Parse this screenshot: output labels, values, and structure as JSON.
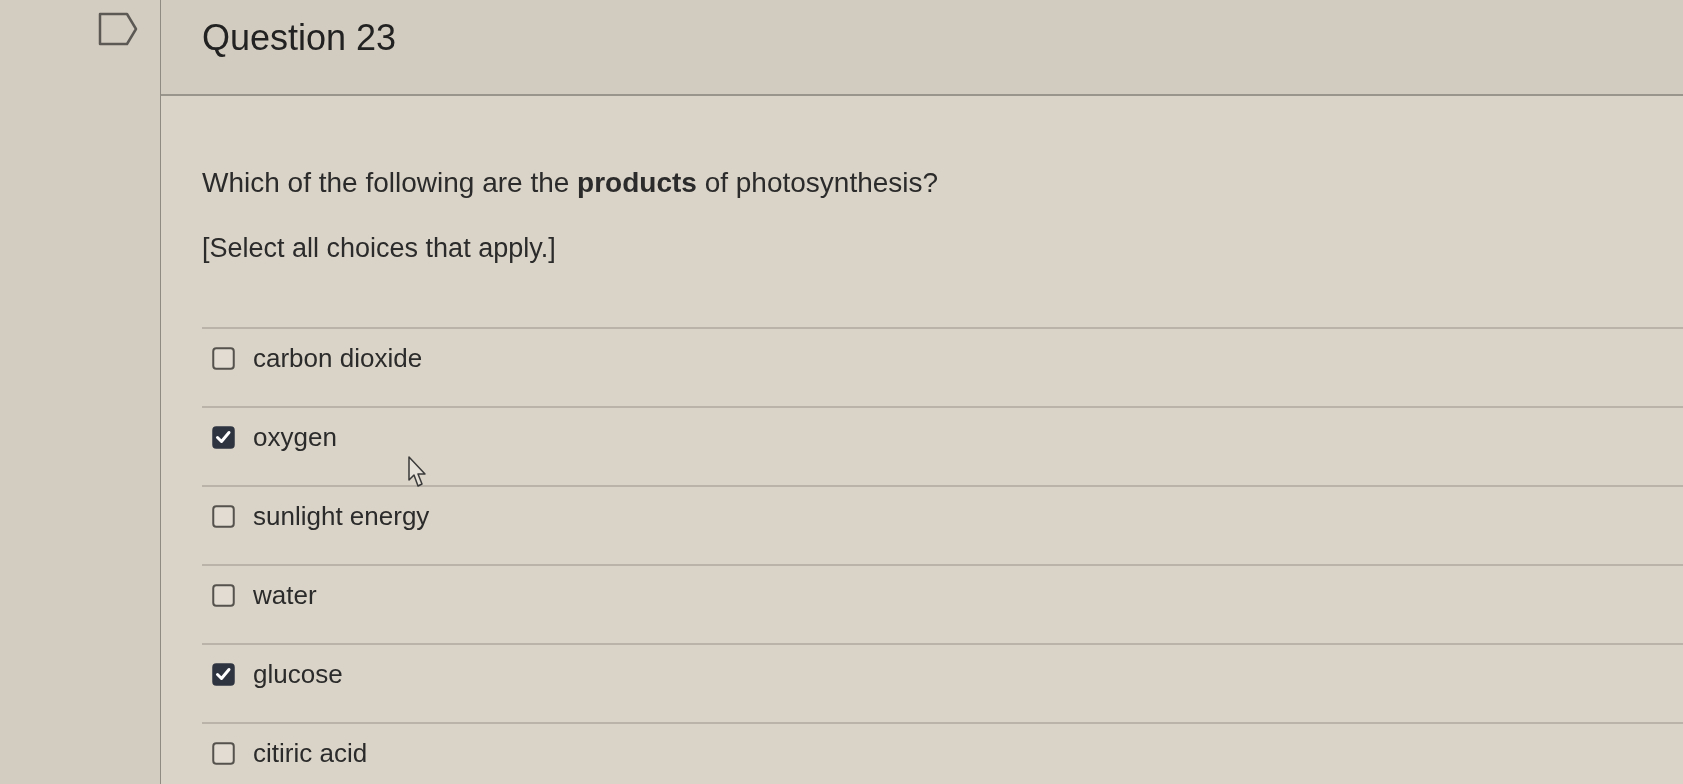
{
  "question": {
    "title": "Question 23",
    "prompt": "Which of the following are the **products** of photosynthesis?",
    "instruction": "[Select all choices that apply.]",
    "choices": [
      {
        "label": "carbon dioxide",
        "checked": false
      },
      {
        "label": "oxygen",
        "checked": true
      },
      {
        "label": "sunlight energy",
        "checked": false
      },
      {
        "label": "water",
        "checked": false
      },
      {
        "label": "glucose",
        "checked": true
      },
      {
        "label": "citiric acid",
        "checked": false
      }
    ]
  }
}
